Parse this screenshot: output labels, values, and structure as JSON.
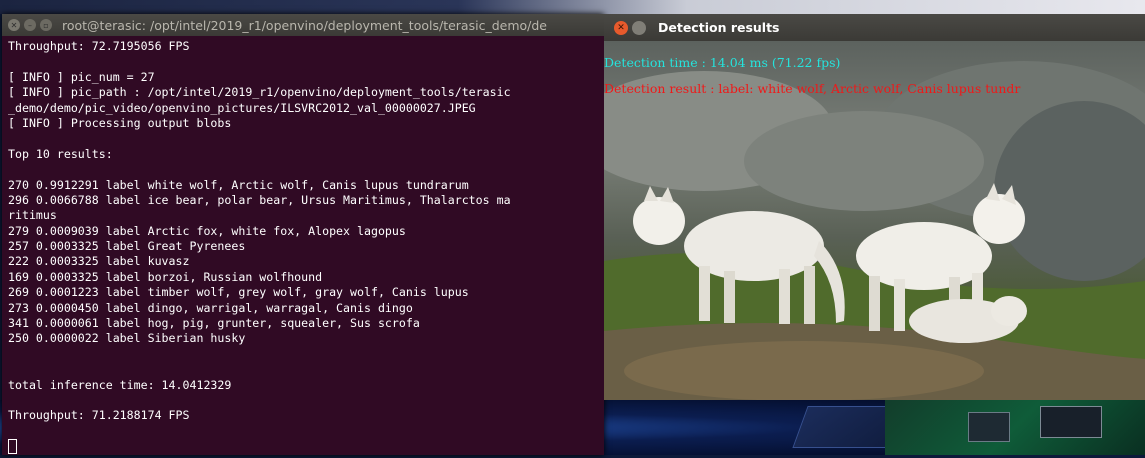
{
  "terminal": {
    "title": "root@terasic: /opt/intel/2019_r1/openvino/deployment_tools/terasic_demo/de",
    "lines": [
      "Throughput: 72.7195056 FPS",
      "",
      "[ INFO ] pic_num = 27",
      "[ INFO ] pic_path : /opt/intel/2019_r1/openvino/deployment_tools/terasic",
      "_demo/demo/pic_video/openvino_pictures/ILSVRC2012_val_00000027.JPEG",
      "[ INFO ] Processing output blobs",
      "",
      "Top 10 results:",
      "",
      "270 0.9912291 label white wolf, Arctic wolf, Canis lupus tundrarum",
      "296 0.0066788 label ice bear, polar bear, Ursus Maritimus, Thalarctos ma",
      "ritimus",
      "279 0.0009039 label Arctic fox, white fox, Alopex lagopus",
      "257 0.0003325 label Great Pyrenees",
      "222 0.0003325 label kuvasz",
      "169 0.0003325 label borzoi, Russian wolfhound",
      "269 0.0001223 label timber wolf, grey wolf, gray wolf, Canis lupus",
      "273 0.0000450 label dingo, warrigal, warragal, Canis dingo",
      "341 0.0000061 label hog, pig, grunter, squealer, Sus scrofa",
      "250 0.0000022 label Siberian husky",
      "",
      "",
      "total inference time: 14.0412329",
      "",
      "Throughput: 71.2188174 FPS",
      ""
    ]
  },
  "image_window": {
    "title": "Detection results",
    "detection_time": "Detection time  : 14.04 ms (71.22 fps)",
    "detection_result": "Detection result  :  label: white wolf, Arctic wolf, Canis lupus tundr",
    "detection_time_color": "#25e3dc",
    "detection_result_color": "#f01818"
  }
}
